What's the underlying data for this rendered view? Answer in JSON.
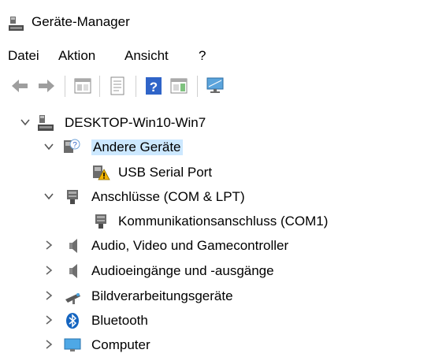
{
  "window": {
    "title": "Geräte-Manager"
  },
  "menu": {
    "items": [
      "Datei",
      "Aktion",
      "Ansicht",
      "?"
    ]
  },
  "toolbar": {
    "buttons": [
      "back-arrow-icon",
      "forward-arrow-icon",
      "properties-pane-icon",
      "details-icon",
      "help-icon",
      "action-pane-icon",
      "monitor-scan-icon"
    ]
  },
  "tree": {
    "root": "DESKTOP-Win10-Win7",
    "nodes": [
      {
        "label": "Andere Geräte",
        "expanded": true,
        "selected": true,
        "icon": "unknown-device-icon",
        "children": [
          {
            "label": "USB Serial Port",
            "icon": "warning-device-icon"
          }
        ]
      },
      {
        "label": "Anschlüsse (COM & LPT)",
        "expanded": true,
        "icon": "port-icon",
        "children": [
          {
            "label": "Kommunikationsanschluss (COM1)",
            "icon": "port-icon"
          }
        ]
      },
      {
        "label": "Audio, Video und Gamecontroller",
        "expanded": false,
        "icon": "speaker-icon"
      },
      {
        "label": "Audioeingänge und -ausgänge",
        "expanded": false,
        "icon": "speaker-icon"
      },
      {
        "label": "Bildverarbeitungsgeräte",
        "expanded": false,
        "icon": "camera-icon"
      },
      {
        "label": "Bluetooth",
        "expanded": false,
        "icon": "bluetooth-icon"
      },
      {
        "label": "Computer",
        "expanded": false,
        "icon": "computer-icon"
      }
    ]
  },
  "colors": {
    "selection": "#cce8ff",
    "chevron": "#555555",
    "bluetooth": "#1565c0",
    "warning": "#f4b400"
  }
}
